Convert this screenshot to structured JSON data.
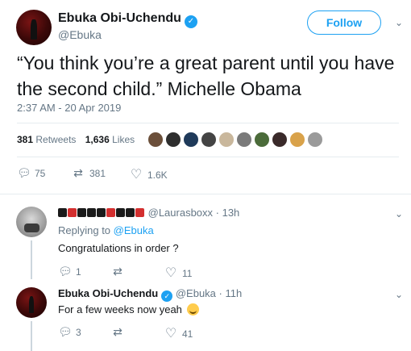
{
  "tweet": {
    "author_name": "Ebuka Obi-Uchendu",
    "author_handle": "@Ebuka",
    "follow_label": "Follow",
    "text": "“You think you’re a great parent until you have the second child.” Michelle Obama",
    "timestamp": "2:37 AM - 20 Apr 2019",
    "retweets_count": "381",
    "retweets_label": "Retweets",
    "likes_count": "1,636",
    "likes_label": "Likes",
    "actions": {
      "replies": "75",
      "retweets": "381",
      "likes": "1.6K"
    }
  },
  "replies": [
    {
      "author_name": "",
      "author_handle": "@Laurasboxx",
      "time": "· 13h",
      "replying_to_prefix": "Replying to",
      "replying_to_handle": "@Ebuka",
      "text": "Congratulations in order ?",
      "actions": {
        "replies": "1",
        "retweets": "",
        "likes": "11"
      }
    },
    {
      "author_name": "Ebuka Obi-Uchendu",
      "author_handle": "@Ebuka",
      "time": "· 11h",
      "text": "For a few weeks now yeah",
      "emoji": "smiling-face",
      "actions": {
        "replies": "3",
        "retweets": "",
        "likes": "41"
      }
    }
  ],
  "icons": {
    "verified": "verified-badge-icon",
    "reply": "reply-icon",
    "retweet": "retweet-icon",
    "like": "heart-icon",
    "chevron": "chevron-down-icon"
  },
  "colors": {
    "accent": "#1da1f2",
    "muted": "#657786",
    "divider": "#e6ecf0",
    "text": "#14171a"
  }
}
